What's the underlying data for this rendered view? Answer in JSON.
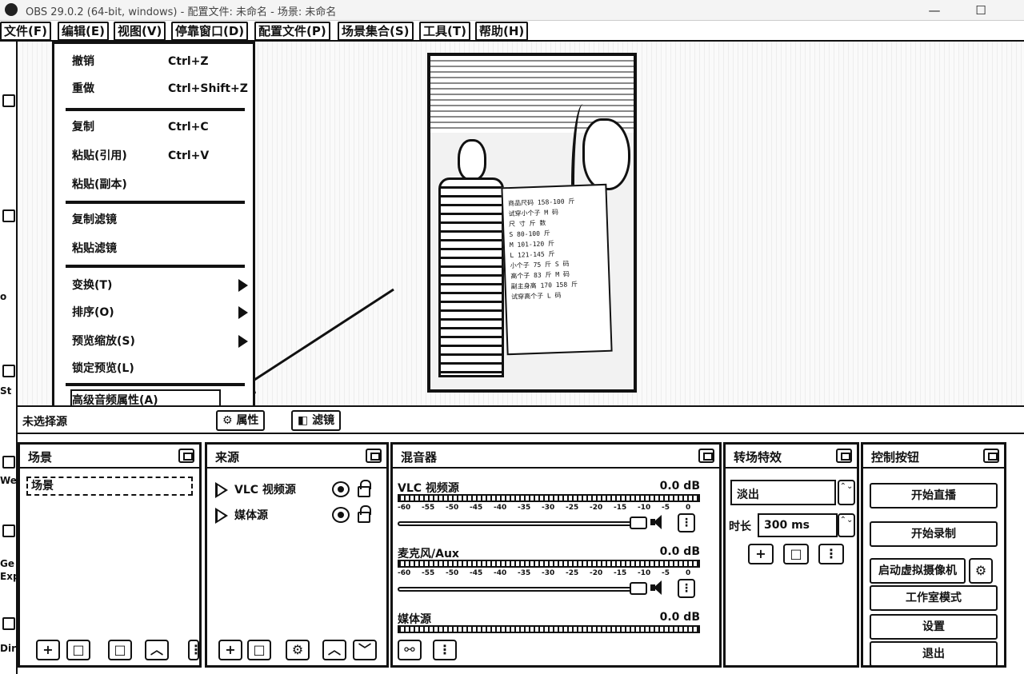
{
  "window": {
    "title": "OBS 29.0.2 (64-bit, windows) - 配置文件: 未命名 - 场景: 未命名",
    "minimize_glyph": "—",
    "maximize_glyph": "☐"
  },
  "menubar": {
    "items": [
      {
        "label": "文件(F)"
      },
      {
        "label": "编辑(E)"
      },
      {
        "label": "视图(V)"
      },
      {
        "label": "停靠窗口(D)"
      },
      {
        "label": "配置文件(P)"
      },
      {
        "label": "场景集合(S)"
      },
      {
        "label": "工具(T)"
      },
      {
        "label": "帮助(H)"
      }
    ]
  },
  "left_strip": {
    "labels": [
      "Ge",
      "Exp",
      "We",
      "Dire",
      "St",
      "o"
    ]
  },
  "edit_menu": {
    "items": [
      {
        "label": "撤销",
        "shortcut": "Ctrl+Z"
      },
      {
        "label": "重做",
        "shortcut": "Ctrl+Shift+Z"
      },
      {
        "label": "复制",
        "shortcut": "Ctrl+C"
      },
      {
        "label": "粘贴(引用)",
        "shortcut": "Ctrl+V"
      },
      {
        "label": "粘贴(副本)",
        "shortcut": ""
      },
      {
        "label": "复制滤镜",
        "shortcut": ""
      },
      {
        "label": "粘贴滤镜",
        "shortcut": ""
      },
      {
        "label": "变换(T)",
        "shortcut": ""
      },
      {
        "label": "排序(O)",
        "shortcut": ""
      },
      {
        "label": "预览缩放(S)",
        "shortcut": ""
      },
      {
        "label": "锁定预览(L)",
        "shortcut": ""
      },
      {
        "label": "高级音频属性(A)",
        "shortcut": ""
      }
    ]
  },
  "preview": {
    "size_sheet_lines": [
      "商品尺码 158-100 斤",
      "试穿小个子 M 码",
      "尺 寸   斤 数",
      "S     80-100 斤",
      "M    101-120 斤",
      "L    121-145 斤",
      "",
      "小个子 75 斤 S 码",
      "高个子 83 斤 M 码",
      "副主身高 170 158 斤",
      "试穿高个子 L 码"
    ]
  },
  "status": {
    "no_source_selected": "未选择源",
    "properties_button": "属性",
    "filters_button": "滤镜"
  },
  "docks": {
    "scenes": {
      "title": "场景",
      "items": [
        "场景"
      ]
    },
    "sources": {
      "title": "来源",
      "items": [
        {
          "name": "VLC 视频源"
        },
        {
          "name": "媒体源"
        }
      ]
    },
    "mixer": {
      "title": "混音器",
      "ticks": [
        "-60",
        "-55",
        "-50",
        "-45",
        "-40",
        "-35",
        "-30",
        "-25",
        "-20",
        "-15",
        "-10",
        "-5",
        "0"
      ],
      "channels": [
        {
          "name": "VLC 视频源",
          "db": "0.0 dB"
        },
        {
          "name": "麦克风/Aux",
          "db": "0.0 dB"
        },
        {
          "name": "媒体源",
          "db": "0.0 dB"
        }
      ]
    },
    "transitions": {
      "title": "转场特效",
      "selected": "淡出",
      "duration_label": "时长",
      "duration_value": "300 ms"
    },
    "controls": {
      "title": "控制按钮",
      "start_streaming": "开始直播",
      "start_recording": "开始录制",
      "start_virtual_camera": "启动虚拟摄像机",
      "studio_mode": "工作室模式",
      "settings": "设置",
      "exit": "退出"
    }
  },
  "icons": {
    "plus": "+",
    "remove": "□",
    "properties": "⚙",
    "up": "︿",
    "down": "﹀",
    "menu": "⋮",
    "spin": "⌃⌄"
  }
}
